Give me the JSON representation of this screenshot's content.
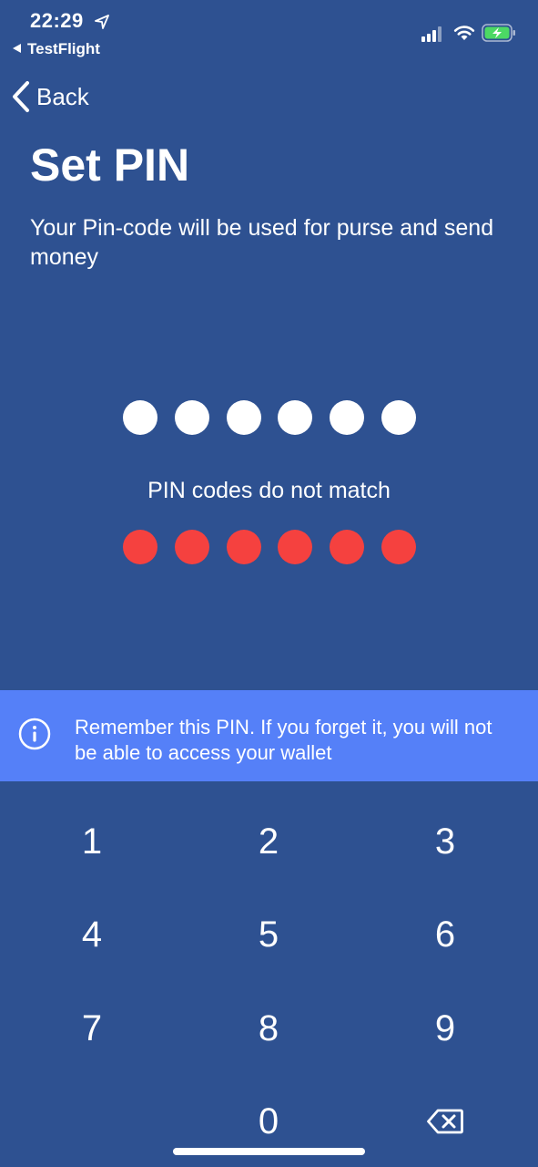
{
  "status_bar": {
    "time": "22:29",
    "back_app": "TestFlight"
  },
  "nav": {
    "back_label": "Back"
  },
  "page": {
    "title": "Set PIN",
    "subtitle": "Your Pin-code will be used for purse and send money",
    "error": "PIN codes do not match",
    "pin_length": 6,
    "entered_digits": 6,
    "confirm_digits": 6
  },
  "banner": {
    "text": "Remember this PIN. If you forget it, you will not be able to access your wallet",
    "icon": "info-icon"
  },
  "keypad": {
    "keys": [
      "1",
      "2",
      "3",
      "4",
      "5",
      "6",
      "7",
      "8",
      "9",
      "",
      "0",
      "delete"
    ]
  },
  "colors": {
    "background": "#2e5191",
    "banner": "#5580f8",
    "error_dot": "#f5413f",
    "dot": "#ffffff"
  }
}
